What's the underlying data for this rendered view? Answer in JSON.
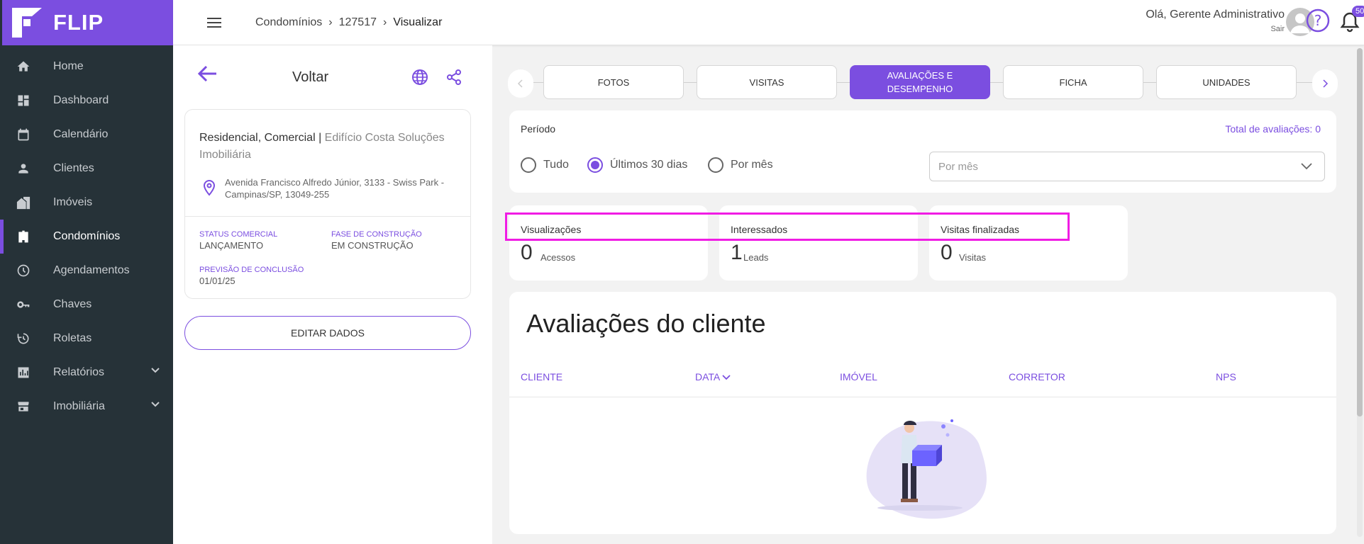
{
  "brand": {
    "name": "FLIP",
    "color": "#7b4ee0"
  },
  "sidebar": {
    "items": [
      {
        "label": "Home",
        "icon": "home-icon"
      },
      {
        "label": "Dashboard",
        "icon": "dashboard-icon"
      },
      {
        "label": "Calendário",
        "icon": "calendar-icon"
      },
      {
        "label": "Clientes",
        "icon": "person-icon"
      },
      {
        "label": "Imóveis",
        "icon": "property-icon"
      },
      {
        "label": "Condomínios",
        "icon": "building-icon",
        "active": true
      },
      {
        "label": "Agendamentos",
        "icon": "clock-icon"
      },
      {
        "label": "Chaves",
        "icon": "key-icon"
      },
      {
        "label": "Roletas",
        "icon": "roulette-icon"
      },
      {
        "label": "Relatórios",
        "icon": "report-icon",
        "expandable": true
      },
      {
        "label": "Imobiliária",
        "icon": "store-icon",
        "expandable": true
      }
    ]
  },
  "topbar": {
    "breadcrumb": [
      "Condomínios",
      "127517",
      "Visualizar"
    ],
    "greeting": "Olá, Gerente Administrativo",
    "logout": "Sair",
    "notifications": "50"
  },
  "left_panel": {
    "back_label": "Voltar",
    "types": "Residencial, Comercial",
    "separator": " | ",
    "name": "Edifício Costa Soluções Imobiliária",
    "address": "Avenida Francisco Alfredo Júnior, 3133 - Swiss Park - Campinas/SP, 13049-255",
    "status_label": "STATUS COMERCIAL",
    "status_value": "LANÇAMENTO",
    "phase_label": "FASE DE CONSTRUÇÃO",
    "phase_value": "EM CONSTRUÇÃO",
    "forecast_label": "PREVISÃO DE CONCLUSÃO",
    "forecast_value": "01/01/25",
    "edit_button": "EDITAR DADOS"
  },
  "tabs": {
    "items": [
      "FOTOS",
      "VISITAS",
      "AVALIAÇÕES E DESEMPENHO",
      "FICHA",
      "UNIDADES"
    ],
    "active_index": 2
  },
  "period": {
    "label": "Período",
    "total": "Total de avaliações: 0",
    "options": [
      "Tudo",
      "Últimos 30 dias",
      "Por mês"
    ],
    "selected_index": 1,
    "month_placeholder": "Por mês"
  },
  "stats": [
    {
      "label": "Visualizações",
      "value": "0",
      "unit": "Acessos"
    },
    {
      "label": "Interessados",
      "value": "1",
      "unit": "Leads"
    },
    {
      "label": "Visitas finalizadas",
      "value": "0",
      "unit": "Visitas"
    }
  ],
  "reviews": {
    "title": "Avaliações do cliente",
    "columns": [
      "CLIENTE",
      "DATA",
      "IMÓVEL",
      "CORRETOR",
      "NPS"
    ]
  },
  "colors": {
    "accent": "#7b4ee0",
    "sidebar": "#263238",
    "highlight": "#f01ce4"
  }
}
